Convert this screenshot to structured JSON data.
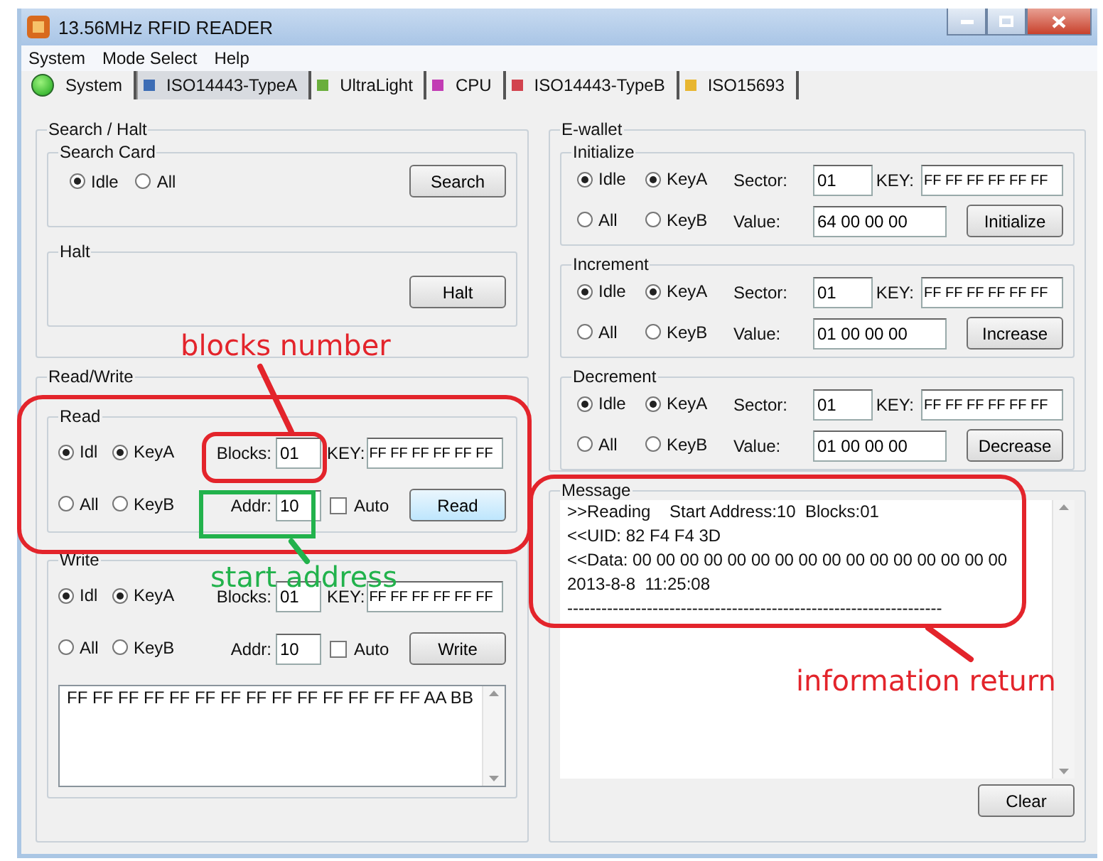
{
  "window": {
    "title": "13.56MHz RFID READER"
  },
  "menu": [
    "System",
    "Mode Select",
    "Help"
  ],
  "mode_tabs": [
    {
      "label": "System",
      "kind": "status",
      "connected": true,
      "selected": false
    },
    {
      "label": "ISO14443-TypeA",
      "kind": "mode",
      "color": "#3d6db5",
      "selected": true
    },
    {
      "label": "UltraLight",
      "kind": "mode",
      "color": "#6aae3c",
      "selected": false
    },
    {
      "label": "CPU",
      "kind": "mode",
      "color": "#c23cb4",
      "selected": false
    },
    {
      "label": "ISO14443-TypeB",
      "kind": "mode",
      "color": "#d2434e",
      "selected": false
    },
    {
      "label": "ISO15693",
      "kind": "mode",
      "color": "#e8b630",
      "selected": false
    }
  ],
  "search_halt": {
    "title": "Search / Halt",
    "search_card": {
      "title": "Search Card",
      "options": [
        {
          "label": "Idle",
          "selected": true
        },
        {
          "label": "All",
          "selected": false
        }
      ],
      "button": "Search"
    },
    "halt": {
      "title": "Halt",
      "button": "Halt"
    }
  },
  "read_write": {
    "title": "Read/Write",
    "sections": [
      {
        "title": "Read",
        "mode_options": [
          {
            "label": "Idl",
            "selected": true
          },
          {
            "label": "All",
            "selected": false
          }
        ],
        "key_options": [
          {
            "label": "KeyA",
            "selected": true
          },
          {
            "label": "KeyB",
            "selected": false
          }
        ],
        "blocks_label": "Blocks:",
        "blocks": "01",
        "key_label": "KEY:",
        "key": "FF FF FF FF FF FF",
        "addr_label": "Addr:",
        "addr": "10",
        "auto": {
          "label": "Auto",
          "checked": false
        },
        "button": "Read"
      },
      {
        "title": "Write",
        "mode_options": [
          {
            "label": "Idl",
            "selected": true
          },
          {
            "label": "All",
            "selected": false
          }
        ],
        "key_options": [
          {
            "label": "KeyA",
            "selected": true
          },
          {
            "label": "KeyB",
            "selected": false
          }
        ],
        "blocks_label": "Blocks:",
        "blocks": "01",
        "key_label": "KEY:",
        "key": "FF FF FF FF FF FF",
        "addr_label": "Addr:",
        "addr": "10",
        "auto": {
          "label": "Auto",
          "checked": false
        },
        "button": "Write",
        "data": "FF FF FF FF FF FF FF FF FF FF FF FF FF FF AA BB"
      }
    ]
  },
  "e_wallet": {
    "title": "E-wallet",
    "sections": [
      {
        "title": "Initialize",
        "mode_options": [
          {
            "label": "Idle",
            "selected": true
          },
          {
            "label": "All",
            "selected": false
          }
        ],
        "key_options": [
          {
            "label": "KeyA",
            "selected": true
          },
          {
            "label": "KeyB",
            "selected": false
          }
        ],
        "sector_label": "Sector:",
        "sector": "01",
        "key_label": "KEY:",
        "key": "FF FF FF FF FF FF",
        "value_label": "Value:",
        "value": "64 00 00 00",
        "button": "Initialize"
      },
      {
        "title": "Increment",
        "mode_options": [
          {
            "label": "Idle",
            "selected": true
          },
          {
            "label": "All",
            "selected": false
          }
        ],
        "key_options": [
          {
            "label": "KeyA",
            "selected": true
          },
          {
            "label": "KeyB",
            "selected": false
          }
        ],
        "sector_label": "Sector:",
        "sector": "01",
        "key_label": "KEY:",
        "key": "FF FF FF FF FF FF",
        "value_label": "Value:",
        "value": "01 00 00 00",
        "button": "Increase"
      },
      {
        "title": "Decrement",
        "mode_options": [
          {
            "label": "Idle",
            "selected": true
          },
          {
            "label": "All",
            "selected": false
          }
        ],
        "key_options": [
          {
            "label": "KeyA",
            "selected": true
          },
          {
            "label": "KeyB",
            "selected": false
          }
        ],
        "sector_label": "Sector:",
        "sector": "01",
        "key_label": "KEY:",
        "key": "FF FF FF FF FF FF",
        "value_label": "Value:",
        "value": "01 00 00 00",
        "button": "Decrease"
      }
    ]
  },
  "message": {
    "title": "Message",
    "lines": [
      ">>Reading    Start Address:10  Blocks:01",
      "<<UID: 82 F4 F4 3D",
      "<<Data: 00 00 00 00 00 00 00 00 00 00 00 00 00 00 00 00",
      "2013-8-8  11:25:08",
      "------------------------------------------------------------------"
    ],
    "button": "Clear"
  },
  "highlight_frames": [
    {
      "color": "#e3242b"
    },
    {
      "color": "#e3242b"
    },
    {
      "color": "#22b24c"
    },
    {
      "color": "#e3242b"
    }
  ],
  "callouts": [
    {
      "text": "blocks number",
      "color": "#e3242b"
    },
    {
      "text": "start address",
      "color": "#22b24c"
    },
    {
      "text": "information return",
      "color": "#e3242b"
    }
  ]
}
